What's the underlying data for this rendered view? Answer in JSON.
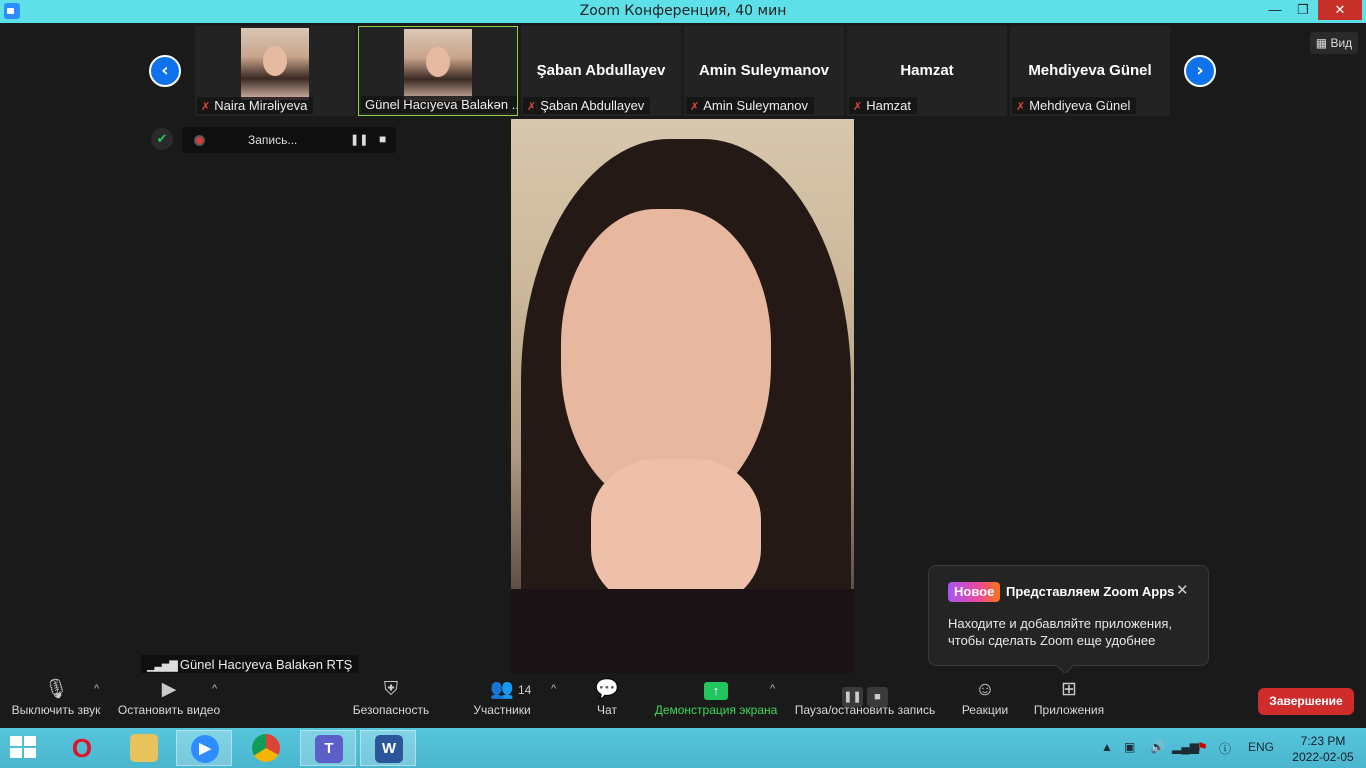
{
  "window": {
    "title": "Zoom Конференция, 40 мин",
    "minimize": "—",
    "maximize": "❐",
    "close": "✕"
  },
  "gallery": {
    "prev_arrow": "‹",
    "next_arrow": "›",
    "participants": [
      {
        "name": "Naira Mirəliyeva",
        "has_video": true
      },
      {
        "name": "Günel Hacıyeva Balakən ...",
        "has_video": true,
        "active": true
      },
      {
        "name": "Şaban Abdullayev",
        "display_name": "Şaban Abdullayev"
      },
      {
        "name": "Amin Suleymanov",
        "display_name": "Amin Suleymanov"
      },
      {
        "name": "Hamzat",
        "display_name": "Hamzat"
      },
      {
        "name": "Mehdiyeva Günel",
        "display_name": "Mehdiyeva Günel"
      }
    ],
    "muted_icon": "mic-muted-icon"
  },
  "view_button": "Вид",
  "recording": {
    "label": "Запись...",
    "pause": "❚❚",
    "stop": "■"
  },
  "active_speaker": {
    "name": "Günel Hacıyeva Balakən RTŞ"
  },
  "popup": {
    "badge": "Новое",
    "title": "Представляем Zoom Apps",
    "body": "Находите и добавляйте приложения, чтобы сделать Zoom еще удобнее",
    "close": "✕"
  },
  "toolbar": {
    "mute": "Выключить звук",
    "video": "Остановить видео",
    "security": "Безопасность",
    "participants": "Участники",
    "participants_count": "14",
    "chat": "Чат",
    "share": "Демонстрация экрана",
    "record": "Пауза/остановить запись",
    "reactions": "Реакции",
    "apps": "Приложения",
    "end": "Завершение",
    "caret": "^"
  },
  "taskbar": {
    "apps": [
      "Opera",
      "File Explorer",
      "Zoom",
      "Chrome",
      "Teams",
      "Word"
    ],
    "language": "ENG",
    "time": "7:23 PM",
    "date": "2022-02-05"
  },
  "colors": {
    "titlebar": "#5ee0e8",
    "accent_blue": "#0e72ed",
    "share_green": "#22c55e",
    "end_red": "#d02c2c",
    "taskbar": "#4ab6cf"
  }
}
